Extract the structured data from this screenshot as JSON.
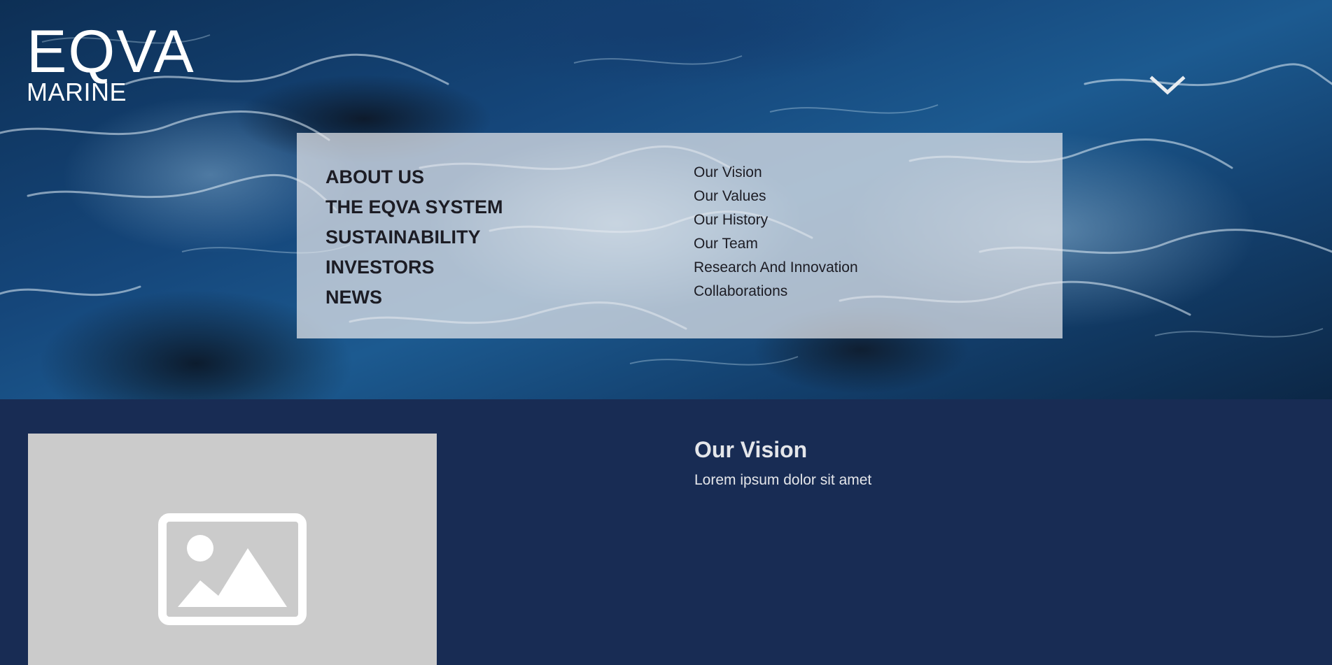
{
  "brand": {
    "logo_text": "EQVA",
    "logo_subtext": "MARINE"
  },
  "header": {
    "menu_toggle_icon": "chevron-down-icon"
  },
  "nav": {
    "primary": [
      {
        "label": "ABOUT US"
      },
      {
        "label": "THE EQVA SYSTEM"
      },
      {
        "label": "SUSTAINABILITY"
      },
      {
        "label": "INVESTORS"
      },
      {
        "label": "NEWS"
      }
    ],
    "secondary": [
      {
        "label": "Our Vision"
      },
      {
        "label": "Our Values"
      },
      {
        "label": "Our History"
      },
      {
        "label": "Our Team"
      },
      {
        "label": "Research And Innovation"
      },
      {
        "label": "Collaborations"
      }
    ]
  },
  "section": {
    "title": "Our Vision",
    "body": "Lorem ipsum dolor sit amet",
    "image_icon": "image-placeholder-icon"
  },
  "colors": {
    "content_background": "#182c54",
    "panel_overlay": "#e6e8ec",
    "nav_text": "#1c1c24",
    "content_text": "#e4e6ea",
    "placeholder": "#cbcbcb"
  }
}
